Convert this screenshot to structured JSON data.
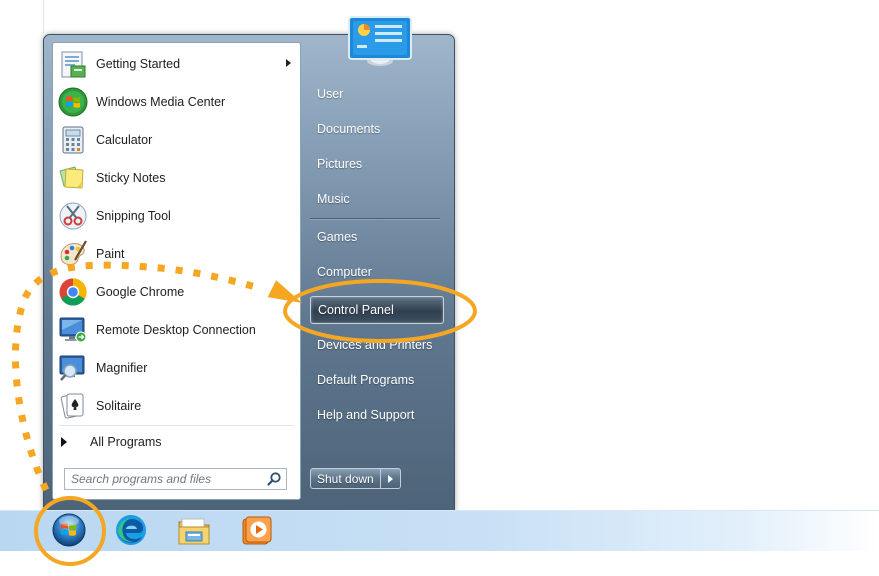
{
  "programs": [
    {
      "label": "Getting Started",
      "icon": "getting-started-icon",
      "has_submenu": true
    },
    {
      "label": "Windows Media Center",
      "icon": "windows-media-center-icon"
    },
    {
      "label": "Calculator",
      "icon": "calculator-icon"
    },
    {
      "label": "Sticky Notes",
      "icon": "sticky-notes-icon"
    },
    {
      "label": "Snipping Tool",
      "icon": "snipping-tool-icon"
    },
    {
      "label": "Paint",
      "icon": "paint-icon"
    },
    {
      "label": "Google Chrome",
      "icon": "chrome-icon"
    },
    {
      "label": "Remote Desktop Connection",
      "icon": "remote-desktop-icon"
    },
    {
      "label": "Magnifier",
      "icon": "magnifier-icon"
    },
    {
      "label": "Solitaire",
      "icon": "solitaire-icon"
    }
  ],
  "all_programs_label": "All Programs",
  "search": {
    "placeholder": "Search programs and files"
  },
  "right_pane": {
    "user": "User",
    "documents": "Documents",
    "pictures": "Pictures",
    "music": "Music",
    "games": "Games",
    "computer": "Computer",
    "control_panel": "Control Panel",
    "devices_printers": "Devices and Printers",
    "default_programs": "Default Programs",
    "help_support": "Help and Support"
  },
  "shutdown_label": "Shut down",
  "taskbar_items": [
    "start-orb-icon",
    "edge-icon",
    "file-explorer-icon",
    "media-player-icon"
  ],
  "colors": {
    "annotation": "#f5a623",
    "active_item": "#2f3f4f"
  }
}
